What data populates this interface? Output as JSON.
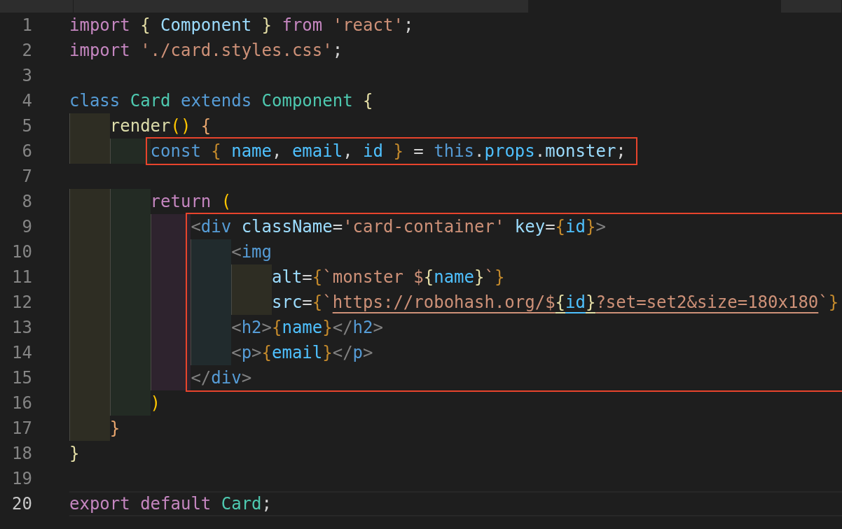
{
  "tabs": [
    {
      "selected": false
    },
    {
      "selected": false
    },
    {
      "selected": true
    },
    {
      "selected": false
    }
  ],
  "lines": [
    {
      "number": "1",
      "current": false,
      "highlighted": false,
      "tokens": [
        {
          "kind": "keyword",
          "text": "import "
        },
        {
          "kind": "brace-a",
          "text": "{"
        },
        {
          "kind": "variable",
          "text": " Component "
        },
        {
          "kind": "brace-a",
          "text": "}"
        },
        {
          "kind": "keyword",
          "text": " from "
        },
        {
          "kind": "string",
          "text": "'react'"
        },
        {
          "kind": "punct",
          "text": ";"
        }
      ]
    },
    {
      "number": "2",
      "current": false,
      "highlighted": false,
      "tokens": [
        {
          "kind": "keyword",
          "text": "import "
        },
        {
          "kind": "string",
          "text": "'./card.styles.css'"
        },
        {
          "kind": "punct",
          "text": ";"
        }
      ]
    },
    {
      "number": "3",
      "current": false,
      "highlighted": false
    },
    {
      "number": "4",
      "current": false,
      "highlighted": false,
      "tokens": [
        {
          "kind": "storage",
          "text": "class "
        },
        {
          "kind": "class",
          "text": "Card"
        },
        {
          "kind": "storage",
          "text": " extends "
        },
        {
          "kind": "class",
          "text": "Component "
        },
        {
          "kind": "brace-a",
          "text": "{"
        }
      ],
      "children": [
        {
          "number": "5",
          "current": false,
          "highlighted": false,
          "tokens": [
            {
              "kind": "function",
              "text": "render"
            },
            {
              "kind": "paren",
              "text": "()"
            },
            {
              "kind": "brace-b",
              "text": " {"
            }
          ],
          "children": [
            {
              "number": "6",
              "current": false,
              "highlighted": true,
              "tokens": [
                {
                  "kind": "storage",
                  "text": "const "
                },
                {
                  "kind": "brace-c",
                  "text": "{"
                },
                {
                  "kind": "prop",
                  "text": " name"
                },
                {
                  "kind": "punct",
                  "text": ", "
                },
                {
                  "kind": "prop",
                  "text": "email"
                },
                {
                  "kind": "punct",
                  "text": ", "
                },
                {
                  "kind": "prop",
                  "text": "id "
                },
                {
                  "kind": "brace-c",
                  "text": "}"
                },
                {
                  "kind": "punct",
                  "text": " = "
                },
                {
                  "kind": "storage",
                  "text": "this"
                },
                {
                  "kind": "punct",
                  "text": "."
                },
                {
                  "kind": "prop",
                  "text": "props"
                },
                {
                  "kind": "punct",
                  "text": "."
                },
                {
                  "kind": "variable",
                  "text": "monster"
                },
                {
                  "kind": "punct",
                  "text": ";"
                }
              ]
            },
            {
              "number": "7",
              "current": false,
              "highlighted": false
            },
            {
              "number": "8",
              "current": false,
              "highlighted": false,
              "tokens": [
                {
                  "kind": "keyword",
                  "text": "return "
                },
                {
                  "kind": "paren",
                  "text": "("
                }
              ],
              "children": [
                {
                  "number": "9",
                  "current": false,
                  "highlighted": true,
                  "tokens": [
                    {
                      "kind": "tag-punct",
                      "text": "<"
                    },
                    {
                      "kind": "tag",
                      "text": "div "
                    },
                    {
                      "kind": "attr",
                      "text": "className"
                    },
                    {
                      "kind": "punct",
                      "text": "="
                    },
                    {
                      "kind": "string",
                      "text": "'card-container' "
                    },
                    {
                      "kind": "attr",
                      "text": "key"
                    },
                    {
                      "kind": "punct",
                      "text": "="
                    },
                    {
                      "kind": "brace-c",
                      "text": "{"
                    },
                    {
                      "kind": "prop",
                      "text": "id"
                    },
                    {
                      "kind": "brace-c",
                      "text": "}"
                    },
                    {
                      "kind": "tag-punct",
                      "text": ">"
                    }
                  ],
                  "children": [
                    {
                      "number": "10",
                      "current": false,
                      "highlighted": true,
                      "tokens": [
                        {
                          "kind": "tag-punct",
                          "text": "<"
                        },
                        {
                          "kind": "tag",
                          "text": "img"
                        }
                      ],
                      "children": [
                        {
                          "number": "11",
                          "current": false,
                          "highlighted": true,
                          "tokens": [
                            {
                              "kind": "attr",
                              "text": "alt"
                            },
                            {
                              "kind": "punct",
                              "text": "="
                            },
                            {
                              "kind": "brace-c",
                              "text": "{"
                            },
                            {
                              "kind": "string",
                              "text": "`monster $"
                            },
                            {
                              "kind": "brace-a",
                              "text": "{"
                            },
                            {
                              "kind": "prop",
                              "text": "name"
                            },
                            {
                              "kind": "brace-a",
                              "text": "}"
                            },
                            {
                              "kind": "string",
                              "text": "`"
                            },
                            {
                              "kind": "brace-c",
                              "text": "}"
                            }
                          ]
                        },
                        {
                          "number": "12",
                          "current": false,
                          "highlighted": true,
                          "tokens": [
                            {
                              "kind": "attr",
                              "text": "src"
                            },
                            {
                              "kind": "punct",
                              "text": "="
                            },
                            {
                              "kind": "brace-c",
                              "text": "{"
                            },
                            {
                              "kind": "string",
                              "text": "`"
                            },
                            {
                              "kind": "link",
                              "text": "https://robohash.org/$"
                            },
                            {
                              "kind": "link-brace",
                              "text": "{"
                            },
                            {
                              "kind": "link-prop",
                              "text": "id"
                            },
                            {
                              "kind": "link-brace",
                              "text": "}"
                            },
                            {
                              "kind": "link",
                              "text": "?set=set2&size=180x180"
                            },
                            {
                              "kind": "string",
                              "text": "`"
                            },
                            {
                              "kind": "brace-c",
                              "text": "}"
                            }
                          ]
                        }
                      ]
                    },
                    {
                      "number": "13",
                      "current": false,
                      "highlighted": true,
                      "tokens": [
                        {
                          "kind": "tag-punct",
                          "text": "<"
                        },
                        {
                          "kind": "tag",
                          "text": "h2"
                        },
                        {
                          "kind": "tag-punct",
                          "text": ">"
                        },
                        {
                          "kind": "brace-c",
                          "text": "{"
                        },
                        {
                          "kind": "prop",
                          "text": "name"
                        },
                        {
                          "kind": "brace-c",
                          "text": "}"
                        },
                        {
                          "kind": "tag-punct",
                          "text": "</"
                        },
                        {
                          "kind": "tag",
                          "text": "h2"
                        },
                        {
                          "kind": "tag-punct",
                          "text": ">"
                        }
                      ]
                    },
                    {
                      "number": "14",
                      "current": false,
                      "highlighted": true,
                      "tokens": [
                        {
                          "kind": "tag-punct",
                          "text": "<"
                        },
                        {
                          "kind": "tag",
                          "text": "p"
                        },
                        {
                          "kind": "tag-punct",
                          "text": ">"
                        },
                        {
                          "kind": "brace-c",
                          "text": "{"
                        },
                        {
                          "kind": "prop",
                          "text": "email"
                        },
                        {
                          "kind": "brace-c",
                          "text": "}"
                        },
                        {
                          "kind": "tag-punct",
                          "text": "</"
                        },
                        {
                          "kind": "tag",
                          "text": "p"
                        },
                        {
                          "kind": "tag-punct",
                          "text": ">"
                        }
                      ]
                    }
                  ]
                },
                {
                  "number": "15",
                  "current": false,
                  "highlighted": true,
                  "tokens": [
                    {
                      "kind": "tag-punct",
                      "text": "</"
                    },
                    {
                      "kind": "tag",
                      "text": "div"
                    },
                    {
                      "kind": "tag-punct",
                      "text": ">"
                    }
                  ]
                }
              ]
            },
            {
              "number": "16",
              "current": false,
              "highlighted": false,
              "tokens": [
                {
                  "kind": "paren",
                  "text": ")"
                }
              ]
            }
          ]
        },
        {
          "number": "17",
          "current": false,
          "highlighted": false,
          "tokens": [
            {
              "kind": "brace-b",
              "text": "}"
            }
          ]
        }
      ]
    },
    {
      "number": "18",
      "current": false,
      "highlighted": false,
      "tokens": [
        {
          "kind": "brace-a",
          "text": "}"
        }
      ]
    },
    {
      "number": "19",
      "current": false,
      "highlighted": false
    },
    {
      "number": "20",
      "current": true,
      "highlighted": false,
      "tokens": [
        {
          "kind": "keyword",
          "text": "export default "
        },
        {
          "kind": "class",
          "text": "Card"
        },
        {
          "kind": "punct",
          "text": ";"
        }
      ]
    }
  ]
}
